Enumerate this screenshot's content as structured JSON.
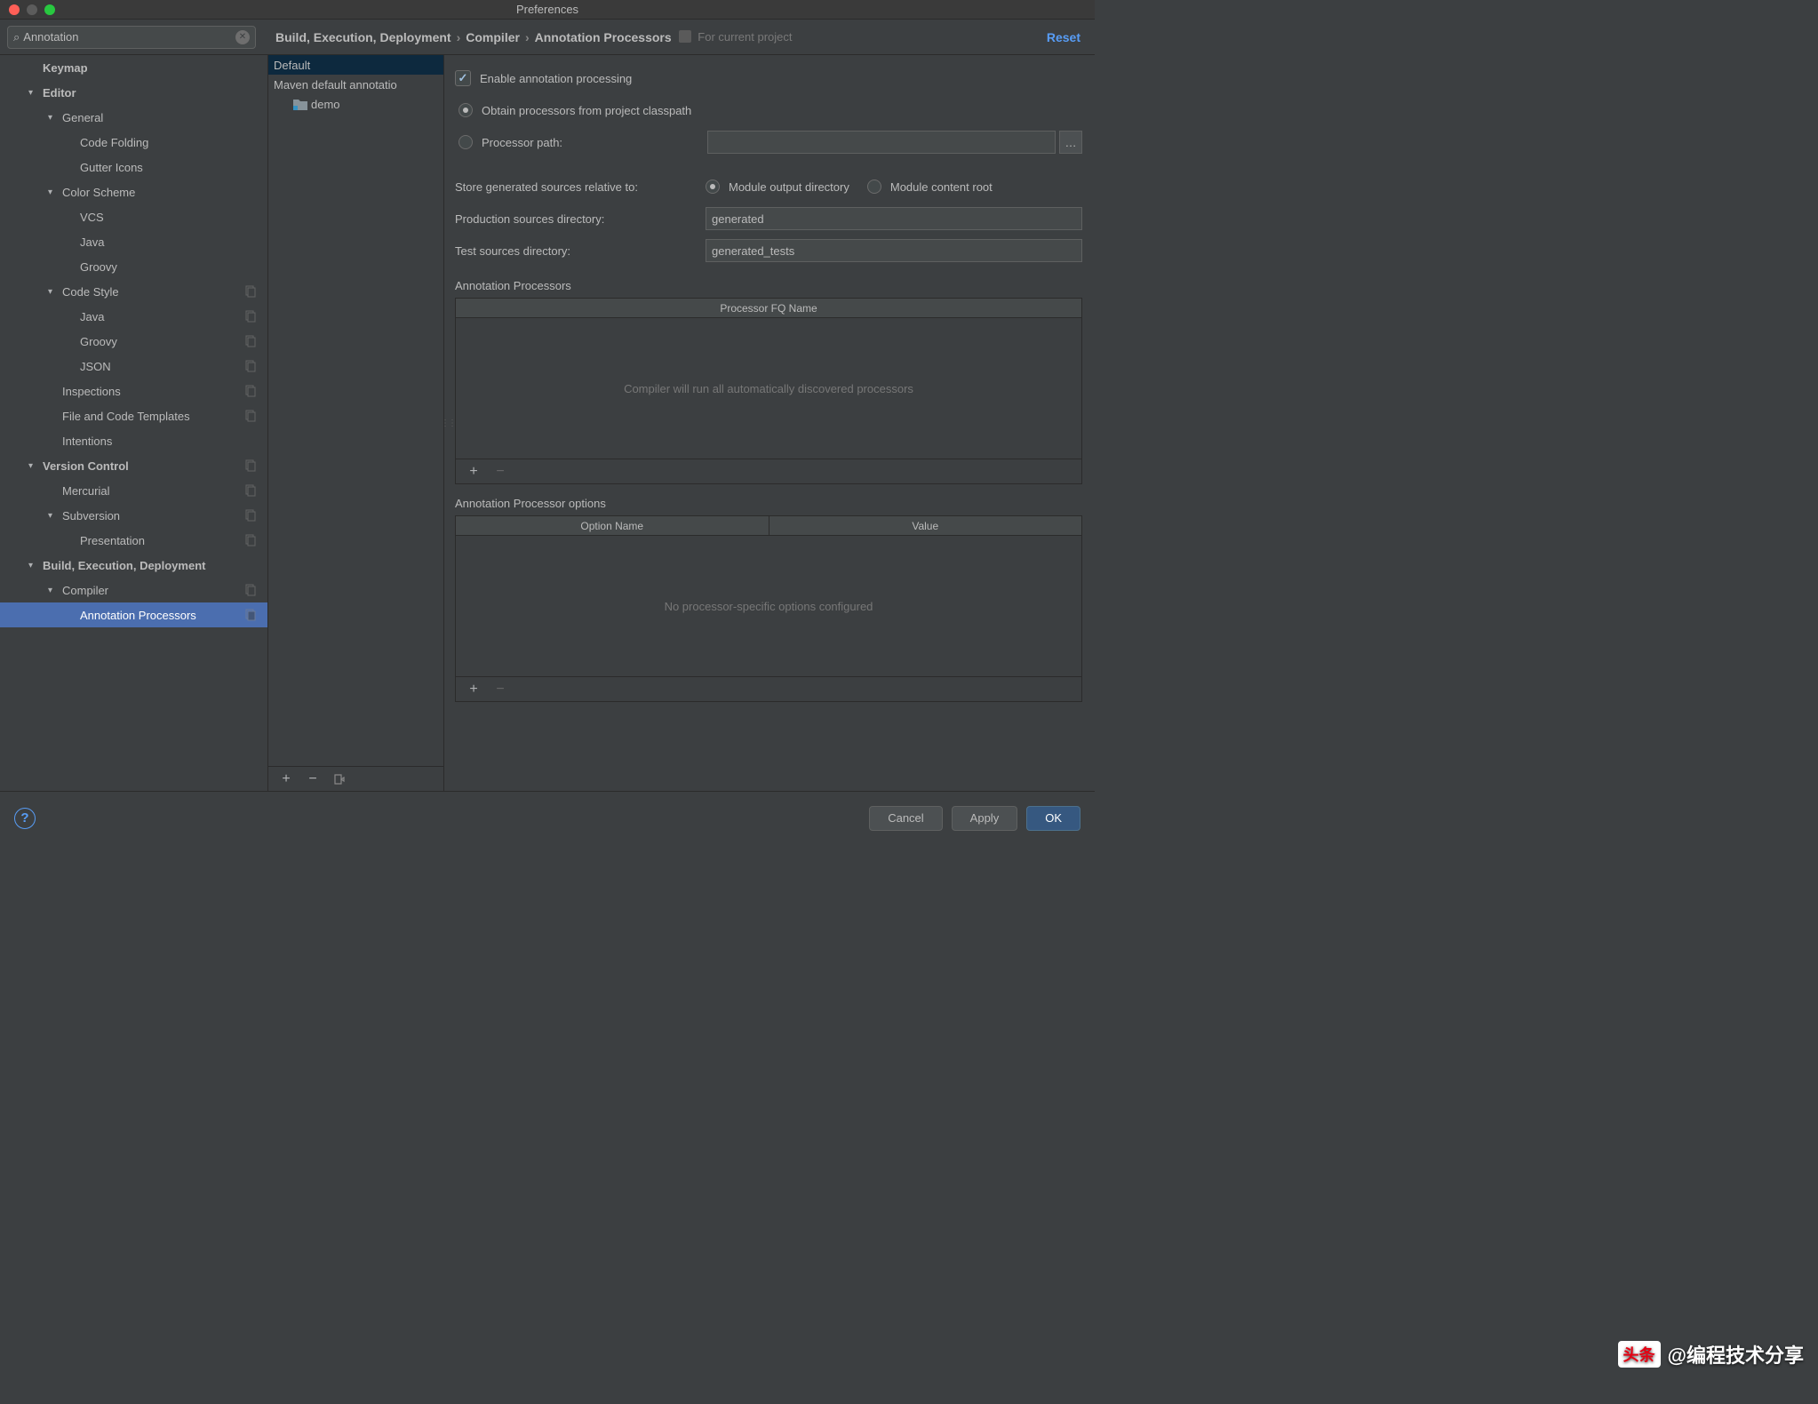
{
  "window": {
    "title": "Preferences"
  },
  "search": {
    "value": "Annotation"
  },
  "breadcrumb": {
    "parts": [
      "Build, Execution, Deployment",
      "Compiler",
      "Annotation Processors"
    ],
    "for_project": "For current project",
    "reset": "Reset"
  },
  "tree": [
    {
      "label": "Keymap",
      "level": 1,
      "bold": true
    },
    {
      "label": "Editor",
      "level": 1,
      "bold": true,
      "arrow": true
    },
    {
      "label": "General",
      "level": 2,
      "arrow": true
    },
    {
      "label": "Code Folding",
      "level": 3
    },
    {
      "label": "Gutter Icons",
      "level": 3
    },
    {
      "label": "Color Scheme",
      "level": 2,
      "arrow": true
    },
    {
      "label": "VCS",
      "level": 3
    },
    {
      "label": "Java",
      "level": 3
    },
    {
      "label": "Groovy",
      "level": 3
    },
    {
      "label": "Code Style",
      "level": 2,
      "arrow": true,
      "copy": true
    },
    {
      "label": "Java",
      "level": 3,
      "copy": true
    },
    {
      "label": "Groovy",
      "level": 3,
      "copy": true
    },
    {
      "label": "JSON",
      "level": 3,
      "copy": true
    },
    {
      "label": "Inspections",
      "level": 2,
      "copy": true
    },
    {
      "label": "File and Code Templates",
      "level": 2,
      "copy": true
    },
    {
      "label": "Intentions",
      "level": 2
    },
    {
      "label": "Version Control",
      "level": 1,
      "bold": true,
      "arrow": true,
      "copy": true
    },
    {
      "label": "Mercurial",
      "level": 2,
      "copy": true
    },
    {
      "label": "Subversion",
      "level": 2,
      "arrow": true,
      "copy": true
    },
    {
      "label": "Presentation",
      "level": 3,
      "copy": true
    },
    {
      "label": "Build, Execution, Deployment",
      "level": 1,
      "bold": true,
      "arrow": true
    },
    {
      "label": "Compiler",
      "level": 2,
      "arrow": true,
      "copy": true
    },
    {
      "label": "Annotation Processors",
      "level": 3,
      "copy": true,
      "selected": true
    }
  ],
  "profiles": {
    "items": [
      "Default",
      "Maven default annotatio"
    ],
    "sub": "demo"
  },
  "form": {
    "enable": "Enable annotation processing",
    "obtain": "Obtain processors from project classpath",
    "processor_path": "Processor path:",
    "processor_path_value": "",
    "store_label": "Store generated sources relative to:",
    "module_output": "Module output directory",
    "module_content": "Module content root",
    "prod_label": "Production sources directory:",
    "prod_value": "generated",
    "test_label": "Test sources directory:",
    "test_value": "generated_tests"
  },
  "tables": {
    "processors_title": "Annotation Processors",
    "processors_header": "Processor FQ Name",
    "processors_empty": "Compiler will run all automatically discovered processors",
    "options_title": "Annotation Processor options",
    "options_h1": "Option Name",
    "options_h2": "Value",
    "options_empty": "No processor-specific options configured"
  },
  "footer": {
    "cancel": "Cancel",
    "apply": "Apply",
    "ok": "OK"
  },
  "watermark": {
    "badge": "头条",
    "text": "@编程技术分享"
  }
}
